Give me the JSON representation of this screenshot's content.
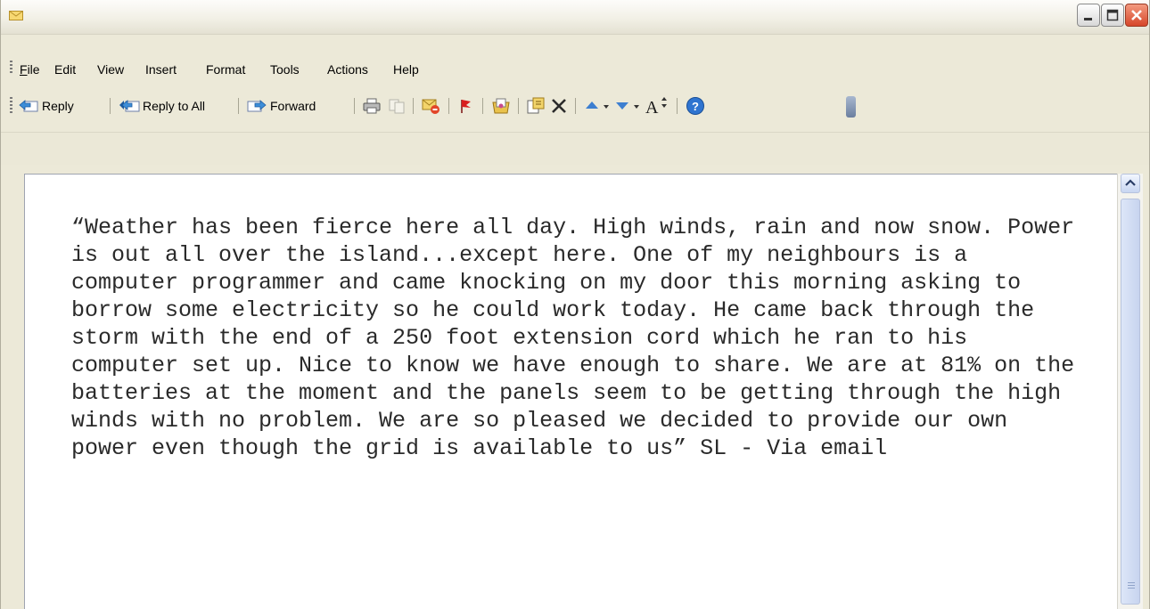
{
  "window": {
    "icon": "envelope-icon",
    "controls": [
      "minimize-icon",
      "maximize-icon",
      "close-icon"
    ]
  },
  "menu": {
    "file": "File",
    "edit": "Edit",
    "view": "View",
    "insert": "Insert",
    "format": "Format",
    "tools": "Tools",
    "actions": "Actions",
    "help": "Help"
  },
  "toolbar": {
    "reply": "Reply",
    "reply_all": "Reply to All",
    "forward": "Forward",
    "icons": [
      "print-icon",
      "copy-icon",
      "move-to-folder-icon",
      "flag-icon",
      "address-book-icon",
      "categorize-icon",
      "delete-icon",
      "previous-item-icon",
      "next-item-icon",
      "font-size-icon",
      "help-icon",
      "toolbar-options-icon"
    ]
  },
  "message": {
    "body": "“Weather has been fierce here all day. High winds, rain and now snow. Power is out all over the island...except here. One of my neighbours is a computer programmer and came knocking on my door this morning asking to borrow some electricity so he could work today. He came back through the storm with the end of a 250 foot extension cord which he ran to his computer set up. Nice to know we have enough to share. We are at 81% on the batteries at the moment and the panels seem to be getting through the high winds with no problem. We are so pleased we decided to provide our own power even though the grid is available to us” SL - Via email"
  },
  "colors": {
    "window_bg": "#ece9d8",
    "close_button": "#d6462a",
    "text": "#2a2a2a"
  }
}
